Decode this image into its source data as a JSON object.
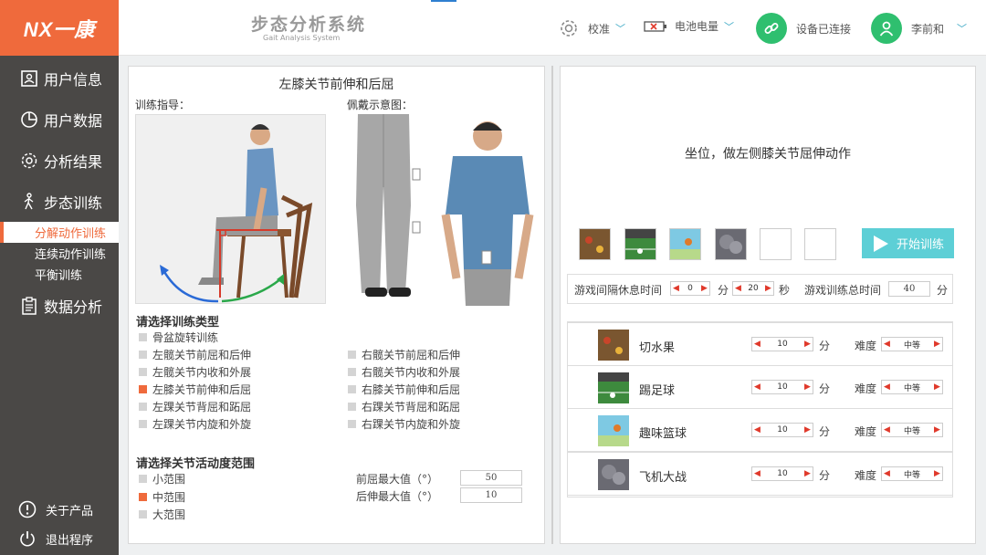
{
  "brand": {
    "logo_text": "NX一康"
  },
  "header": {
    "title": "步态分析系统",
    "subtitle": "Gait Analysis System",
    "calibrate": "校准",
    "battery": "电池电量",
    "device_status": "设备已连接",
    "user_name": "李前和"
  },
  "sidebar": {
    "items": [
      {
        "label": "用户信息",
        "icon": "user-card-icon"
      },
      {
        "label": "用户数据",
        "icon": "pie-chart-icon"
      },
      {
        "label": "分析结果",
        "icon": "gear-icon"
      },
      {
        "label": "步态训练",
        "icon": "walking-person-icon"
      }
    ],
    "sub_items": [
      {
        "label": "分解动作训练",
        "active": true
      },
      {
        "label": "连续动作训练",
        "active": false
      },
      {
        "label": "平衡训练",
        "active": false
      }
    ],
    "data_analysis": "数据分析",
    "about": "关于产品",
    "exit": "退出程序"
  },
  "left_panel": {
    "title": "左膝关节前伸和后屈",
    "guide_label": "训练指导：",
    "wear_label": "佩戴示意图：",
    "type_heading": "请选择训练类型",
    "types_left": [
      {
        "label": "骨盆旋转训练",
        "selected": false
      },
      {
        "label": "左髋关节前屈和后伸",
        "selected": false
      },
      {
        "label": "左髋关节内收和外展",
        "selected": false
      },
      {
        "label": "左膝关节前伸和后屈",
        "selected": true
      },
      {
        "label": "左踝关节背屈和跖屈",
        "selected": false
      },
      {
        "label": "左踝关节内旋和外旋",
        "selected": false
      }
    ],
    "types_right": [
      {
        "label": "右髋关节前屈和后伸",
        "selected": false
      },
      {
        "label": "右髋关节内收和外展",
        "selected": false
      },
      {
        "label": "右膝关节前伸和后屈",
        "selected": false
      },
      {
        "label": "右踝关节背屈和跖屈",
        "selected": false
      },
      {
        "label": "右踝关节内旋和外旋",
        "selected": false
      }
    ],
    "range_heading": "请选择关节活动度范围",
    "ranges": [
      {
        "label": "小范围",
        "selected": false
      },
      {
        "label": "中范围",
        "selected": true
      },
      {
        "label": "大范围",
        "selected": false
      }
    ],
    "flex_max_label": "前屈最大值（°）",
    "flex_max_value": "50",
    "ext_max_label": "后伸最大值（°）",
    "ext_max_value": "10"
  },
  "right_panel": {
    "instruction": "坐位，做左侧膝关节屈伸动作",
    "start_label": "开始训练",
    "rest_label": "游戏间隔休息时间",
    "rest_min": "0",
    "min_unit": "分",
    "rest_sec": "20",
    "sec_unit": "秒",
    "total_label": "游戏训练总时间",
    "total_value": "40",
    "total_unit": "分",
    "games": [
      {
        "name": "切水果",
        "minutes": "10",
        "unit": "分",
        "difficulty_label": "难度",
        "difficulty": "中等"
      },
      {
        "name": "踢足球",
        "minutes": "10",
        "unit": "分",
        "difficulty_label": "难度",
        "difficulty": "中等"
      },
      {
        "name": "趣味篮球",
        "minutes": "10",
        "unit": "分",
        "difficulty_label": "难度",
        "difficulty": "中等"
      },
      {
        "name": "飞机大战",
        "minutes": "10",
        "unit": "分",
        "difficulty_label": "难度",
        "difficulty": "中等"
      }
    ]
  },
  "colors": {
    "accent": "#ef6a3c",
    "sidebar": "#4a4846",
    "start": "#5dcfd6",
    "connected": "#2fbf6f"
  }
}
